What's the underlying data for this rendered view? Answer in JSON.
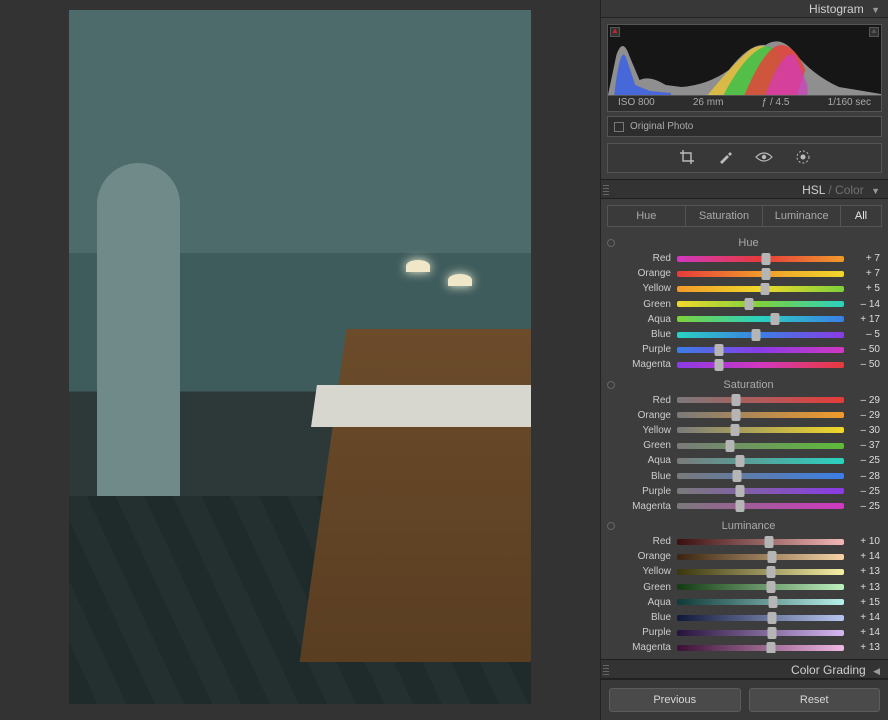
{
  "histogram": {
    "title": "Histogram",
    "iso": "ISO 800",
    "focal": "26 mm",
    "aperture": "ƒ / 4.5",
    "shutter": "1/160 sec",
    "original_label": "Original Photo"
  },
  "tools": {
    "crop": "crop-icon",
    "spot": "spot-removal-icon",
    "eye": "redeye-icon",
    "radial": "masking-icon"
  },
  "hsl": {
    "title_pre": "HSL",
    "title_sep": " / ",
    "title_post": "Color",
    "tabs": {
      "hue": "Hue",
      "sat": "Saturation",
      "lum": "Luminance",
      "all": "All"
    },
    "groups": [
      {
        "name": "Hue",
        "kind": "hue",
        "rows": [
          {
            "label": "Red",
            "value": 7,
            "cls": "g-red"
          },
          {
            "label": "Orange",
            "value": 7,
            "cls": "g-orange"
          },
          {
            "label": "Yellow",
            "value": 5,
            "cls": "g-yellow"
          },
          {
            "label": "Green",
            "value": -14,
            "cls": "g-green"
          },
          {
            "label": "Aqua",
            "value": 17,
            "cls": "g-aqua"
          },
          {
            "label": "Blue",
            "value": -5,
            "cls": "g-blue"
          },
          {
            "label": "Purple",
            "value": -50,
            "cls": "g-purple"
          },
          {
            "label": "Magenta",
            "value": -50,
            "cls": "g-magenta"
          }
        ]
      },
      {
        "name": "Saturation",
        "kind": "sat",
        "rows": [
          {
            "label": "Red",
            "value": -29,
            "cls": "s-red"
          },
          {
            "label": "Orange",
            "value": -29,
            "cls": "s-orange"
          },
          {
            "label": "Yellow",
            "value": -30,
            "cls": "s-yellow"
          },
          {
            "label": "Green",
            "value": -37,
            "cls": "s-green"
          },
          {
            "label": "Aqua",
            "value": -25,
            "cls": "s-aqua"
          },
          {
            "label": "Blue",
            "value": -28,
            "cls": "s-blue"
          },
          {
            "label": "Purple",
            "value": -25,
            "cls": "s-purple"
          },
          {
            "label": "Magenta",
            "value": -25,
            "cls": "s-magenta"
          }
        ]
      },
      {
        "name": "Luminance",
        "kind": "lum",
        "rows": [
          {
            "label": "Red",
            "value": 10,
            "cls": "l-red"
          },
          {
            "label": "Orange",
            "value": 14,
            "cls": "l-orange"
          },
          {
            "label": "Yellow",
            "value": 13,
            "cls": "l-yellow"
          },
          {
            "label": "Green",
            "value": 13,
            "cls": "l-green"
          },
          {
            "label": "Aqua",
            "value": 15,
            "cls": "l-aqua"
          },
          {
            "label": "Blue",
            "value": 14,
            "cls": "l-blue"
          },
          {
            "label": "Purple",
            "value": 14,
            "cls": "l-purple"
          },
          {
            "label": "Magenta",
            "value": 13,
            "cls": "l-magenta"
          }
        ]
      }
    ]
  },
  "color_grading": {
    "title": "Color Grading"
  },
  "footer": {
    "previous": "Previous",
    "reset": "Reset"
  }
}
